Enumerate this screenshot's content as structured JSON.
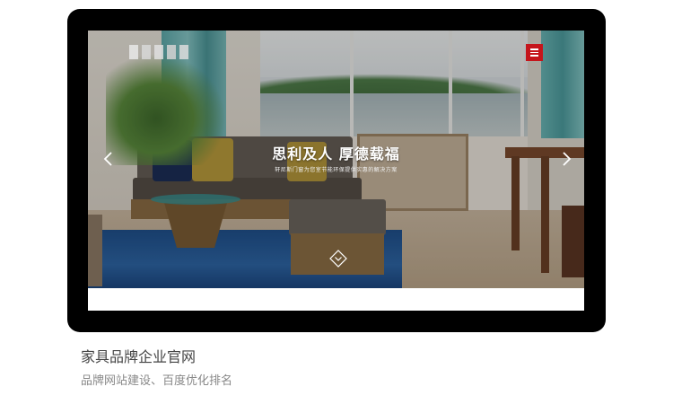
{
  "hero": {
    "headline": "思利及人 厚德载福",
    "subline": "轩尼斯门窗为您室节能环保提供实惠的解决方案"
  },
  "icons": {
    "menu": "hamburger-menu-icon",
    "prev": "chevron-left-icon",
    "next": "chevron-right-icon",
    "scroll": "scroll-down-diamond-icon"
  },
  "colors": {
    "menu_button": "#c5151b",
    "device_frame": "#000000",
    "caption_title": "#444444",
    "caption_sub": "#888888"
  },
  "caption": {
    "title": "家具品牌企业官网",
    "subtitle": "品牌网站建设、百度优化排名"
  }
}
